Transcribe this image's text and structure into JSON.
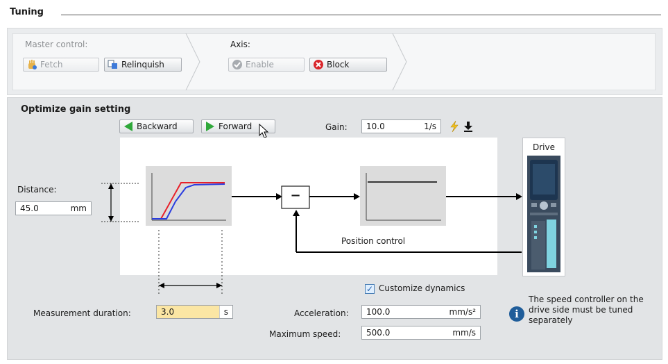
{
  "header": {
    "title": "Tuning"
  },
  "master_control": {
    "label": "Master control:",
    "fetch_label": "Fetch",
    "relinquish_label": "Relinquish"
  },
  "axis": {
    "label": "Axis:",
    "enable_label": "Enable",
    "block_label": "Block"
  },
  "optimize": {
    "title": "Optimize gain setting",
    "backward_label": "Backward",
    "forward_label": "Forward",
    "gain_label": "Gain:",
    "gain_value": "10.0",
    "gain_unit": "1/s"
  },
  "diagram": {
    "distance_label": "Distance:",
    "distance_value": "45.0",
    "distance_unit": "mm",
    "position_control_label": "Position control",
    "drive_label": "Drive",
    "summer_symbol": "−"
  },
  "measurement": {
    "label": "Measurement duration:",
    "value": "3.0",
    "unit": "s"
  },
  "dynamics": {
    "customize_label": "Customize dynamics",
    "customize_checked": true,
    "acceleration_label": "Acceleration:",
    "acceleration_value": "100.0",
    "acceleration_unit": "mm/s²",
    "max_speed_label": "Maximum speed:",
    "max_speed_value": "500.0",
    "max_speed_unit": "mm/s"
  },
  "info": {
    "text": "The speed controller on the drive side must be tuned separately"
  },
  "colors": {
    "setpoint_curve": "#e8202a",
    "actual_curve": "#2a3de0",
    "forward_arrow": "#2fa83a",
    "block_icon": "#d9262b",
    "info_icon": "#1f5d9a",
    "measurement_field": "#fbe6a4",
    "drive_display": "#1d3550",
    "drive_accent": "#7fd3e0"
  }
}
